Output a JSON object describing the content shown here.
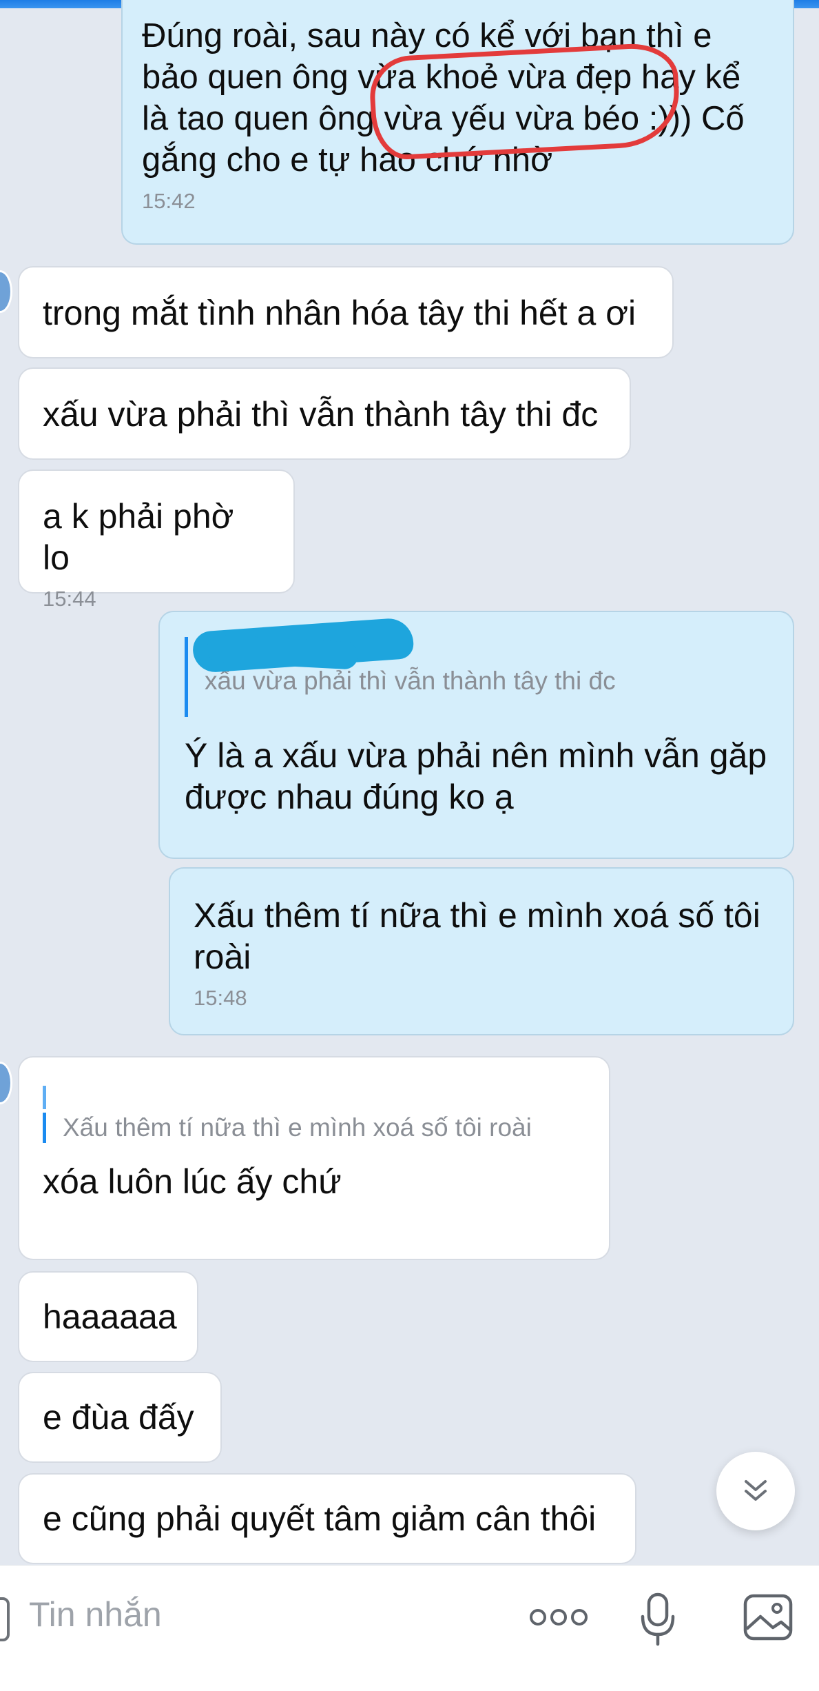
{
  "messages": {
    "m1": {
      "text": "Đúng roài, sau này có kể với bạn thì e\nbảo quen ông vừa khoẻ vừa đẹp hay kể\nlà tao quen ông vừa yếu vừa béo :))) Cố\ngắng cho e tự hào chứ nhờ",
      "time": "15:42"
    },
    "m2": {
      "text": "trong mắt tình nhân hóa tây thi hết a ơi"
    },
    "m3": {
      "text": "xấu vừa phải thì vẫn thành tây thi đc"
    },
    "m4": {
      "text": "a k phải phờ lo",
      "time": "15:44"
    },
    "m5": {
      "quote": "xấu vừa phải thì vẫn thành tây thi đc",
      "text": "Ý là a xấu vừa phải nên mình vẫn găp\nđược nhau đúng ko ạ"
    },
    "m6": {
      "text": "Xấu thêm tí nữa thì e mình xoá số tôi\nroài",
      "time": "15:48"
    },
    "m7": {
      "quote": "Xấu thêm tí nữa thì e mình xoá số tôi roài",
      "text": "xóa luôn lúc ấy chứ"
    },
    "m8": {
      "text": "haaaaaa"
    },
    "m9": {
      "text": "e đùa đấy"
    },
    "m10": {
      "text": "e cũng phải quyết tâm giảm cân thôi"
    }
  },
  "composer": {
    "placeholder": "Tin nhắn"
  },
  "icons": {
    "scroll": "chevron-double-down-icon",
    "more": "more-dots-icon",
    "mic": "microphone-icon",
    "image": "image-icon"
  },
  "colors": {
    "background": "#e3e8f0",
    "incoming": "#ffffff",
    "outgoing": "#d5eefb",
    "accent": "#1b8bf0",
    "annotation": "#e33b3b"
  }
}
